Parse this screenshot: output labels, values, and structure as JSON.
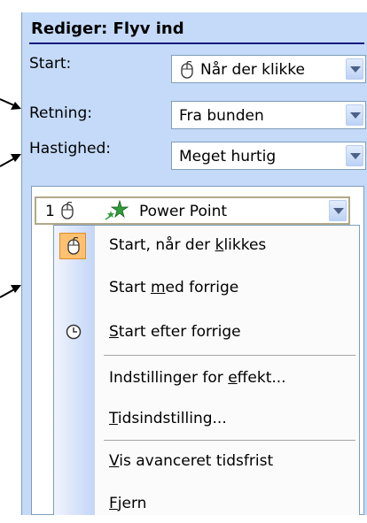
{
  "pane": {
    "title": "Rediger: Flyv ind",
    "fields": [
      {
        "label": "Start:",
        "value": "Når der klikke",
        "icon": "mouse-icon"
      },
      {
        "label": "Retning:",
        "value": "Fra bunden"
      },
      {
        "label": "Hastighed:",
        "value": "Meget hurtig"
      }
    ],
    "list": {
      "item_number": "1",
      "item_name": "Power Point"
    },
    "menu": {
      "items": [
        {
          "pre": "Start, når der ",
          "u": "k",
          "post": "likkes",
          "icon": "mouse-icon",
          "checked": true
        },
        {
          "pre": "Start ",
          "u": "m",
          "post": "ed forrige"
        },
        {
          "pre": "",
          "u": "S",
          "post": "tart efter forrige",
          "icon": "clock-icon"
        },
        {
          "pre": "Indstillinger for ",
          "u": "e",
          "post": "ffekt..."
        },
        {
          "pre": "",
          "u": "T",
          "post": "idsindstilling..."
        },
        {
          "pre": "",
          "u": "V",
          "post": "is avanceret tidsfrist"
        },
        {
          "pre": "",
          "u": "F",
          "post": "jern"
        }
      ]
    }
  },
  "colors": {
    "pane_bg": "#c4daf8",
    "highlight": "#ffc170",
    "border": "#7f9db9"
  }
}
